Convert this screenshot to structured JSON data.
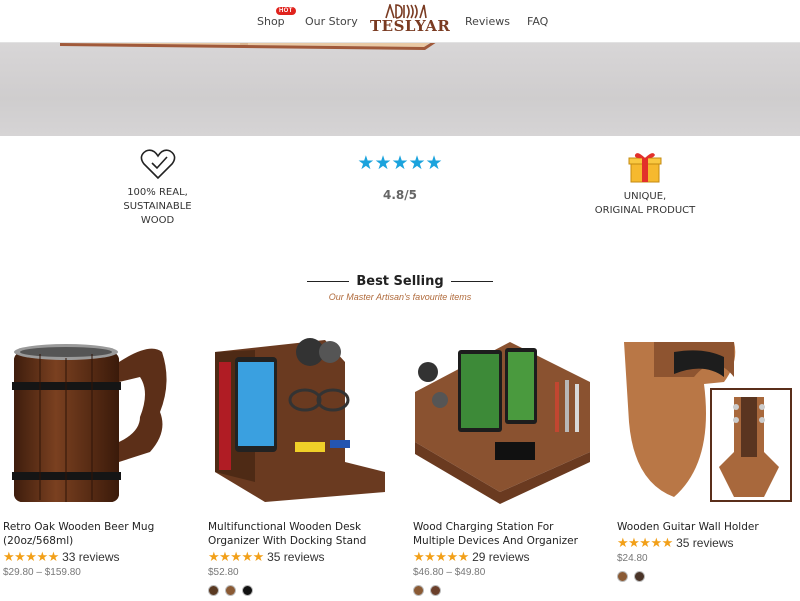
{
  "header": {
    "nav": {
      "shop": "Shop",
      "hot_badge": "HOT",
      "our_story": "Our Story",
      "reviews": "Reviews",
      "faq": "FAQ"
    },
    "logo_text": "TESLYAR"
  },
  "features": {
    "wood": {
      "text_line1": "100% REAL, SUSTAINABLE",
      "text_line2": "WOOD",
      "icon": "heart-check-icon"
    },
    "rating": {
      "stars": "★★★★★",
      "value": "4.8/5",
      "star_color": "#1ba3dd"
    },
    "unique": {
      "text_line1": "UNIQUE,",
      "text_line2": "ORIGINAL PRODUCT",
      "icon": "gift-icon"
    }
  },
  "best_selling": {
    "title": "Best Selling",
    "subtitle": "Our Master Artisan's favourite items"
  },
  "products": [
    {
      "name": "Retro Oak Wooden Beer Mug (20oz/568ml)",
      "stars": "★★★★★",
      "reviews": "33 reviews",
      "price": "$29.80 – $159.80",
      "swatches": []
    },
    {
      "name": "Multifunctional Wooden Desk Organizer With Docking Stand",
      "stars": "★★★★★",
      "reviews": "35 reviews",
      "price": "$52.80",
      "swatches": [
        "#5a3a22",
        "#8a5a34",
        "#111111"
      ]
    },
    {
      "name": "Wood Charging Station For Multiple Devices And Organizer",
      "stars": "★★★★★",
      "reviews": "29 reviews",
      "price": "$46.80 – $49.80",
      "swatches": [
        "#8a5a34",
        "#6b3f2a"
      ]
    },
    {
      "name": "Wooden Guitar Wall Holder",
      "stars": "★★★★★",
      "reviews": "35 reviews",
      "price": "$24.80",
      "swatches": [
        "#8a5a34",
        "#4a3428"
      ]
    }
  ],
  "colors": {
    "accent": "#b06a3b",
    "star_orange": "#f2a019",
    "brand": "#7a3b22"
  }
}
